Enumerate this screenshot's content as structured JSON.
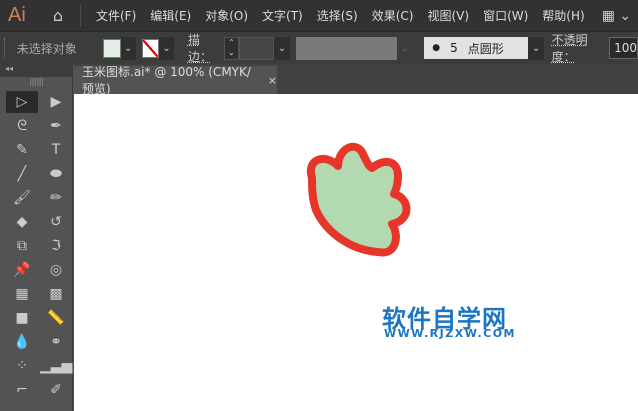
{
  "app": {
    "logo": "Ai",
    "home_icon": "home-icon"
  },
  "menu": [
    "文件(F)",
    "编辑(E)",
    "对象(O)",
    "文字(T)",
    "选择(S)",
    "效果(C)",
    "视图(V)",
    "窗口(W)",
    "帮助(H)"
  ],
  "control": {
    "selection_status": "未选择对象",
    "fill_color": "#e4efe4",
    "stroke_label": "描边：",
    "brush_dot": "●",
    "brush_size": "5",
    "brush_name": "点圆形",
    "opacity_label": "不透明度：",
    "opacity_value": "100"
  },
  "document": {
    "tab_title": "玉米图标.ai* @ 100% (CMYK/预览)",
    "close": "×"
  },
  "artwork": {
    "fill": "#b3d9b1",
    "stroke": "#e8352a"
  },
  "watermark": {
    "title": "软件自学网",
    "url": "WWW.RJZXW.COM"
  },
  "tools": [
    {
      "name": "selection-tool",
      "glyph": "▷"
    },
    {
      "name": "direct-selection-tool",
      "glyph": "▶"
    },
    {
      "name": "lasso-tool",
      "glyph": "ᘓ"
    },
    {
      "name": "pen-tool",
      "glyph": "✒"
    },
    {
      "name": "curvature-tool",
      "glyph": "✎"
    },
    {
      "name": "type-tool",
      "glyph": "T"
    },
    {
      "name": "line-tool",
      "glyph": "╱"
    },
    {
      "name": "ellipse-tool",
      "glyph": "⬬"
    },
    {
      "name": "paintbrush-tool",
      "glyph": "🖌"
    },
    {
      "name": "pencil-tool",
      "glyph": "✏"
    },
    {
      "name": "eraser-tool",
      "glyph": "◆"
    },
    {
      "name": "rotate-tool",
      "glyph": "↺"
    },
    {
      "name": "scale-tool",
      "glyph": "⧉"
    },
    {
      "name": "warp-tool",
      "glyph": "ℑ"
    },
    {
      "name": "puppet-warp-tool",
      "glyph": "📌"
    },
    {
      "name": "shape-builder-tool",
      "glyph": "◎"
    },
    {
      "name": "perspective-grid-tool",
      "glyph": "▦"
    },
    {
      "name": "mesh-tool",
      "glyph": "▩"
    },
    {
      "name": "gradient-tool",
      "glyph": "■"
    },
    {
      "name": "measure-tool",
      "glyph": "📏"
    },
    {
      "name": "eyedropper-tool",
      "glyph": "💧"
    },
    {
      "name": "blend-tool",
      "glyph": "⚭"
    },
    {
      "name": "symbol-sprayer-tool",
      "glyph": "⁘"
    },
    {
      "name": "graph-tool",
      "glyph": "▁▃▅"
    },
    {
      "name": "artboard-tool",
      "glyph": "⌐"
    },
    {
      "name": "slice-tool",
      "glyph": "✐"
    }
  ]
}
